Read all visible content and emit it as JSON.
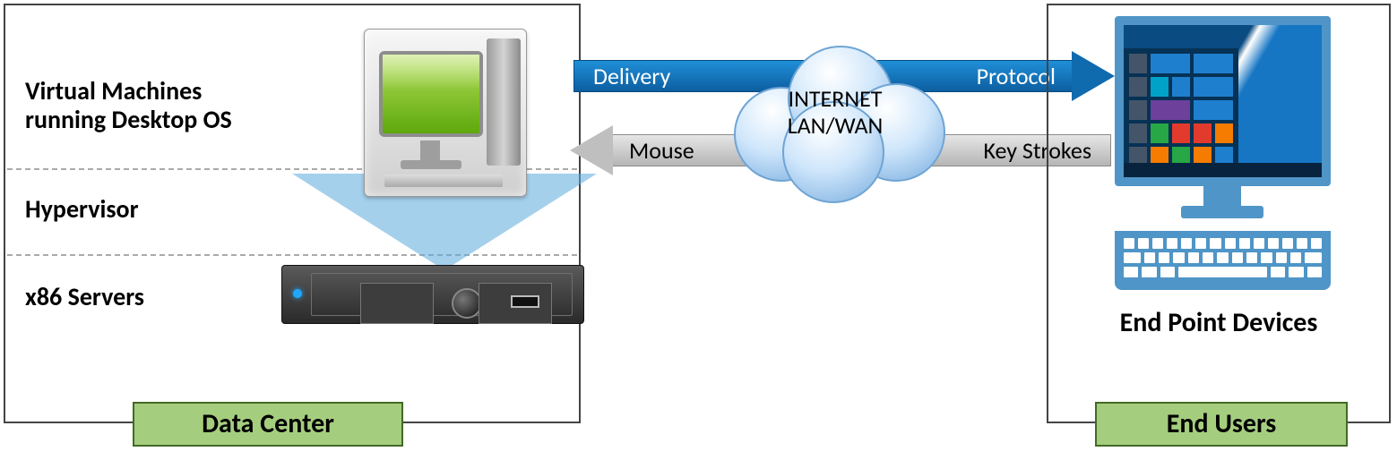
{
  "datacenter": {
    "title": "Data Center",
    "layers": {
      "vm": "Virtual Machines\nrunning Desktop OS",
      "hypervisor": "Hypervisor",
      "servers": "x86 Servers"
    }
  },
  "flow": {
    "top_left_label": "Delivery",
    "top_right_label": "Protocol",
    "bottom_left_label": "Mouse",
    "bottom_right_label": "Key Strokes"
  },
  "cloud": {
    "line1": "INTERNET",
    "line2": "LAN/WAN"
  },
  "endusers": {
    "device_label": "End Point Devices",
    "title": "End Users"
  }
}
